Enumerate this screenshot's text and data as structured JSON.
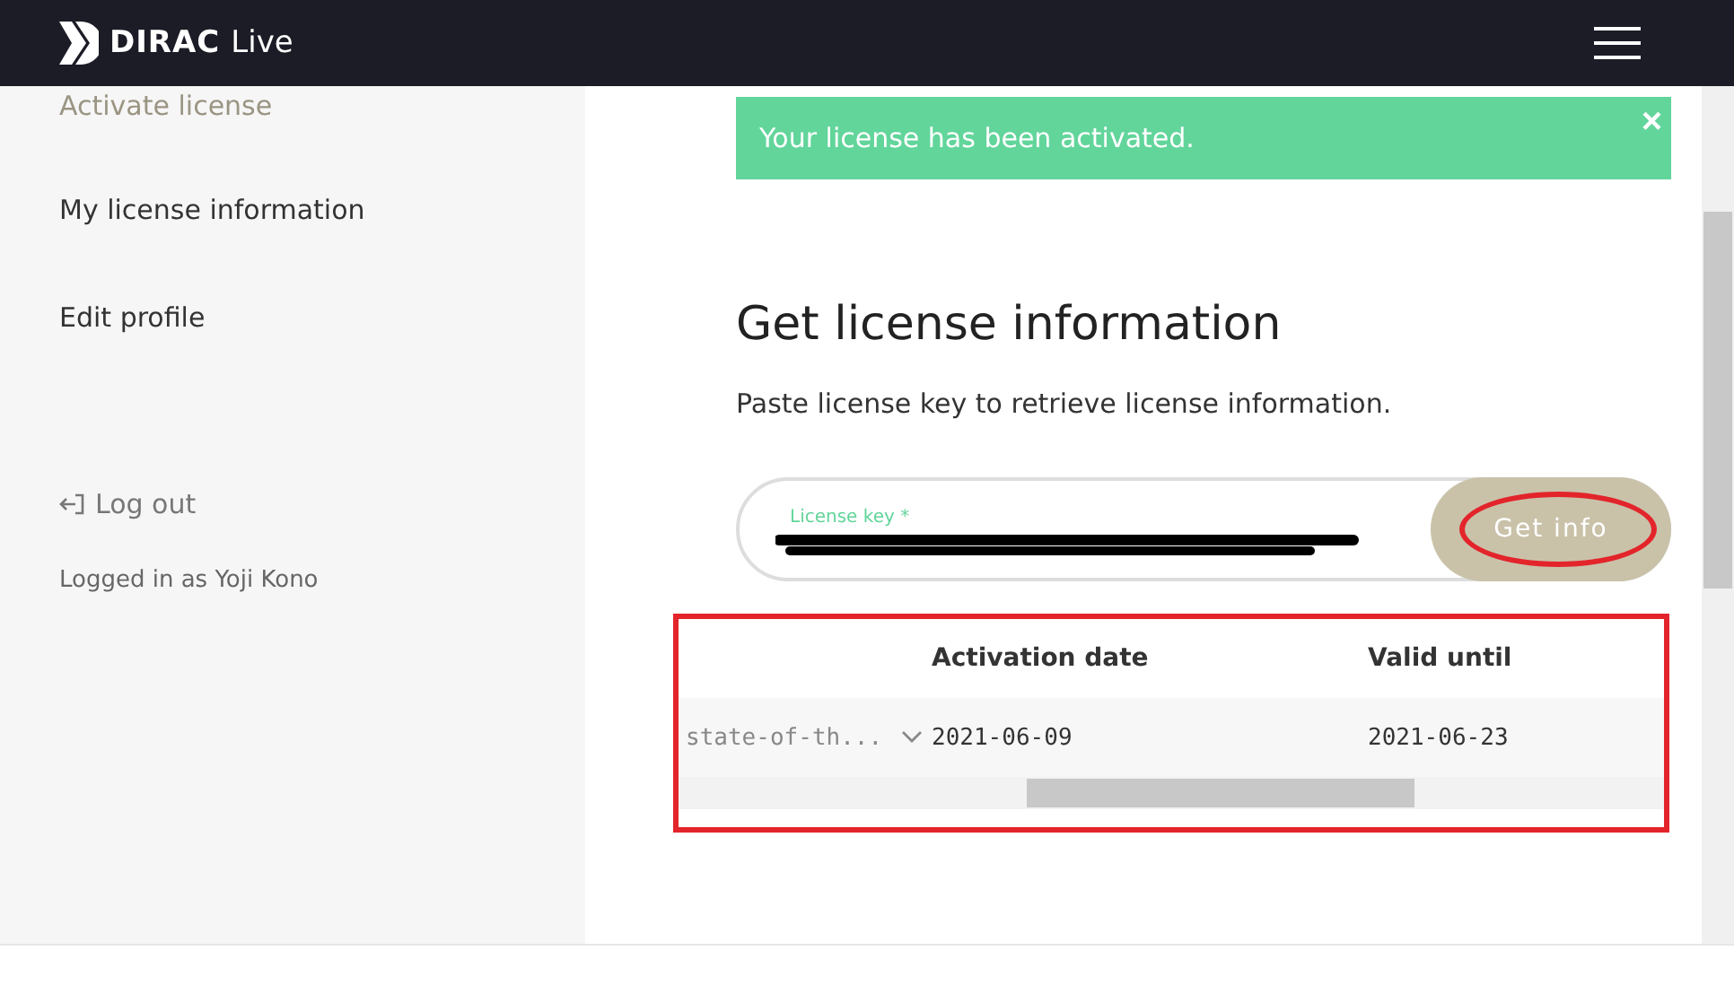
{
  "header": {
    "logo_brand": "DIRAC",
    "logo_product": "Live"
  },
  "sidebar": {
    "items": [
      {
        "label": "Activate license",
        "dimmed": true
      },
      {
        "label": "My license information",
        "dimmed": false
      },
      {
        "label": "Edit profile",
        "dimmed": false
      }
    ],
    "logout": "Log out",
    "logged_in_as": "Logged in as Yoji Kono"
  },
  "alert": {
    "message": "Your license has been activated.",
    "close": "×"
  },
  "main": {
    "title": "Get license information",
    "description": "Paste license key to retrieve license information.",
    "field": {
      "label": "License key *",
      "redacted": true
    },
    "button": "Get info"
  },
  "table": {
    "columns": [
      "Activation date",
      "Valid until"
    ],
    "rows": [
      {
        "column_1": "state-of-th...",
        "activation": "2021-06-09",
        "valid": "2021-06-23"
      }
    ]
  }
}
